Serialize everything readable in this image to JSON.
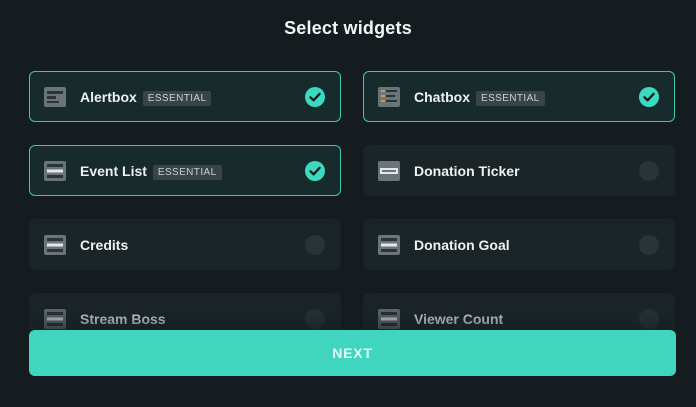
{
  "title": "Select widgets",
  "badge_label": "ESSENTIAL",
  "colors": {
    "background": "#151c1f",
    "card": "#1b2528",
    "accent": "#40d5be",
    "selected_border": "#3dc7b1"
  },
  "widgets": [
    {
      "label": "Alertbox",
      "essential": true,
      "selected": true,
      "icon": "alertbox-widget-icon"
    },
    {
      "label": "Chatbox",
      "essential": true,
      "selected": true,
      "icon": "chatbox-widget-icon"
    },
    {
      "label": "Event List",
      "essential": true,
      "selected": true,
      "icon": "event-list-widget-icon"
    },
    {
      "label": "Donation Ticker",
      "essential": false,
      "selected": false,
      "icon": "donation-ticker-widget-icon"
    },
    {
      "label": "Credits",
      "essential": false,
      "selected": false,
      "icon": "credits-widget-icon"
    },
    {
      "label": "Donation Goal",
      "essential": false,
      "selected": false,
      "icon": "donation-goal-widget-icon"
    },
    {
      "label": "Stream Boss",
      "essential": false,
      "selected": false,
      "icon": "stream-boss-widget-icon"
    },
    {
      "label": "Viewer Count",
      "essential": false,
      "selected": false,
      "icon": "viewer-count-widget-icon"
    }
  ],
  "next_button": {
    "label": "NEXT"
  }
}
